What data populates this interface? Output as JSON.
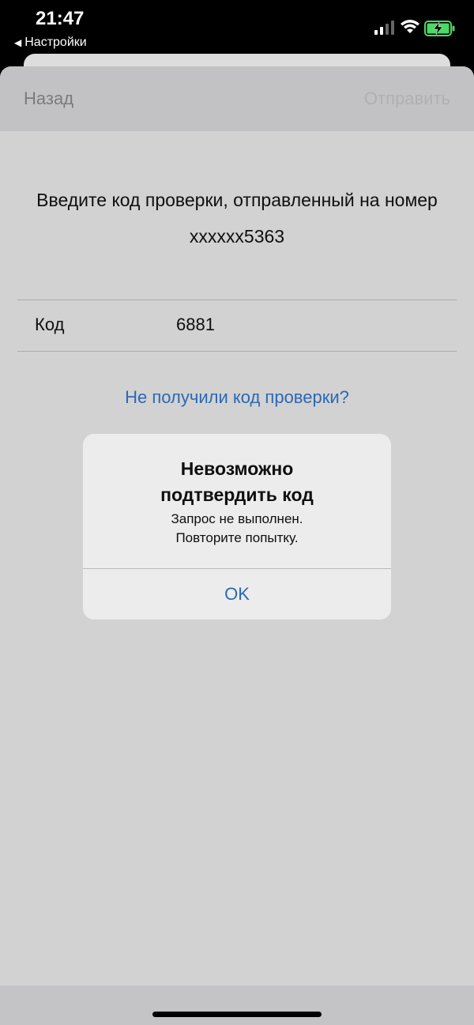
{
  "status_bar": {
    "time": "21:47",
    "back_app": "Настройки",
    "icons": [
      "signal-icon",
      "wifi-icon",
      "battery-charging-icon"
    ],
    "battery_color": "#4cd964"
  },
  "nav": {
    "back_label": "Назад",
    "send_label": "Отправить"
  },
  "prompt": {
    "line1": "Введите код проверки, отправленный на номер",
    "line2": "xxxxxx5363"
  },
  "code_row": {
    "label": "Код",
    "value": "6881"
  },
  "resend_link": "Не получили код проверки?",
  "alert": {
    "title_line1": "Невозможно",
    "title_line2": "подтвердить код",
    "message_line1": "Запрос не выполнен.",
    "message_line2": "Повторите попытку.",
    "ok_label": "OK"
  },
  "colors": {
    "accent": "#2c68b5"
  }
}
